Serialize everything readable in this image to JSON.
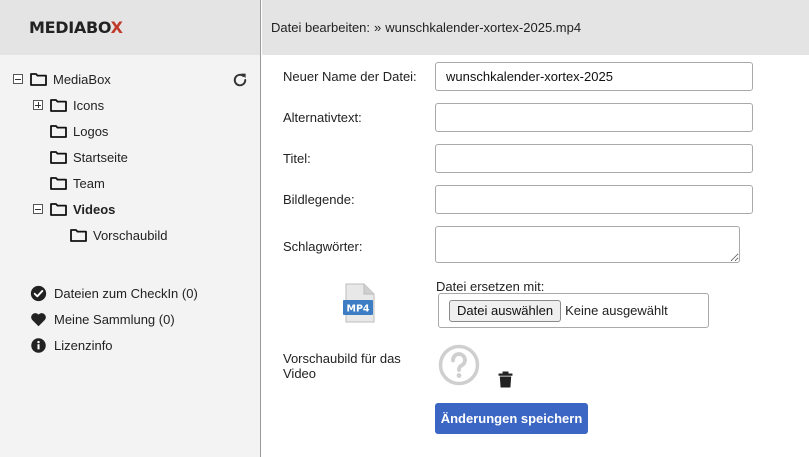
{
  "app": {
    "logo_text": "MEDIABO",
    "logo_accent": "X",
    "accent_color": "#c0392b"
  },
  "header": {
    "prefix": "Datei bearbeiten:",
    "separator": "»",
    "filename": "wunschkalender-xortex-2025.mp4"
  },
  "tree": {
    "root": {
      "label": "MediaBox",
      "expanded": true
    },
    "items": [
      {
        "label": "Icons",
        "toggle": "plus"
      },
      {
        "label": "Logos"
      },
      {
        "label": "Startseite"
      },
      {
        "label": "Team"
      },
      {
        "label": "Videos",
        "toggle": "minus",
        "selected": true
      },
      {
        "label": "Vorschaubild"
      }
    ]
  },
  "sidebar_links": [
    {
      "label": "Dateien zum CheckIn (0)",
      "icon": "check-circle-icon"
    },
    {
      "label": "Meine Sammlung (0)",
      "icon": "heart-icon"
    },
    {
      "label": "Lizenzinfo",
      "icon": "info-icon"
    }
  ],
  "form": {
    "name_label": "Neuer Name der Datei:",
    "name_value": "wunschkalender-xortex-2025",
    "alt_label": "Alternativtext:",
    "alt_value": "",
    "title_label": "Titel:",
    "title_value": "",
    "caption_label": "Bildlegende:",
    "caption_value": "",
    "tags_label": "Schlagwörter:",
    "tags_value": "",
    "file_type_badge": "MP4",
    "replace_label": "Datei ersetzen mit:",
    "file_button": "Datei auswählen",
    "file_status": "Keine ausgewählt",
    "thumb_label": "Vorschaubild für das Video",
    "save_button": "Änderungen speichern"
  }
}
